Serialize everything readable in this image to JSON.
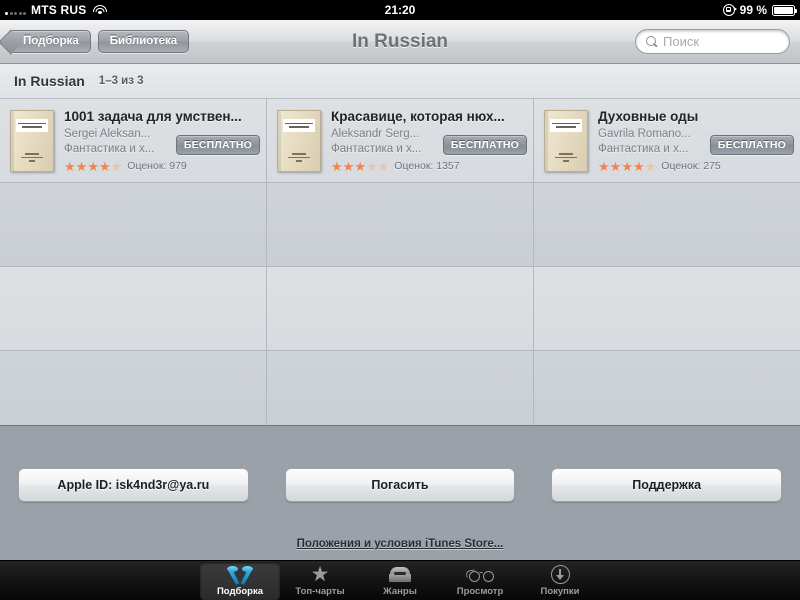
{
  "status_bar": {
    "carrier": "MTS RUS",
    "wifi_icon": "wifi-icon",
    "time": "21:20",
    "rotation_lock_icon": "rotation-lock-icon",
    "battery_percent": "99 %",
    "battery_icon": "battery-icon"
  },
  "nav_bar": {
    "back_button": "Подборка",
    "library_button": "Библиотека",
    "title": "In Russian",
    "search_placeholder": "Поиск",
    "search_value": "",
    "search_icon": "search-icon"
  },
  "section": {
    "title": "In Russian",
    "count": "1–3 из 3"
  },
  "books": [
    {
      "title": "1001 задача для умствен...",
      "author": "Sergei Aleksan...",
      "genre": "Фантастика и х...",
      "price": "БЕСПЛАТНО",
      "stars": 4,
      "rating_count": "Оценок: 979"
    },
    {
      "title": "Красавице, которая нюх...",
      "author": "Aleksandr Serg...",
      "genre": "Фантастика и х...",
      "price": "БЕСПЛАТНО",
      "stars": 3,
      "rating_count": "Оценок: 1357"
    },
    {
      "title": "Духовные оды",
      "author": "Gavrila Romano...",
      "genre": "Фантастика и х...",
      "price": "БЕСПЛАТНО",
      "stars": 4,
      "rating_count": "Оценок: 275"
    }
  ],
  "footer": {
    "apple_id_button": "Apple ID: isk4nd3r@ya.ru",
    "redeem_button": "Погасить",
    "support_button": "Поддержка",
    "terms_link": "Положения и условия iTunes Store..."
  },
  "tab_bar": {
    "items": [
      {
        "label": "Подборка",
        "icon": "ribbon-icon",
        "selected": true
      },
      {
        "label": "Топ-чарты",
        "icon": "star-icon",
        "selected": false
      },
      {
        "label": "Жанры",
        "icon": "box-icon",
        "selected": false
      },
      {
        "label": "Просмотр",
        "icon": "glasses-icon",
        "selected": false
      },
      {
        "label": "Покупки",
        "icon": "download-icon",
        "selected": false
      }
    ]
  },
  "colors": {
    "accent_star": "#f4844a",
    "footer_bg": "#9aa1a9",
    "nav_title": "#6d7178"
  }
}
